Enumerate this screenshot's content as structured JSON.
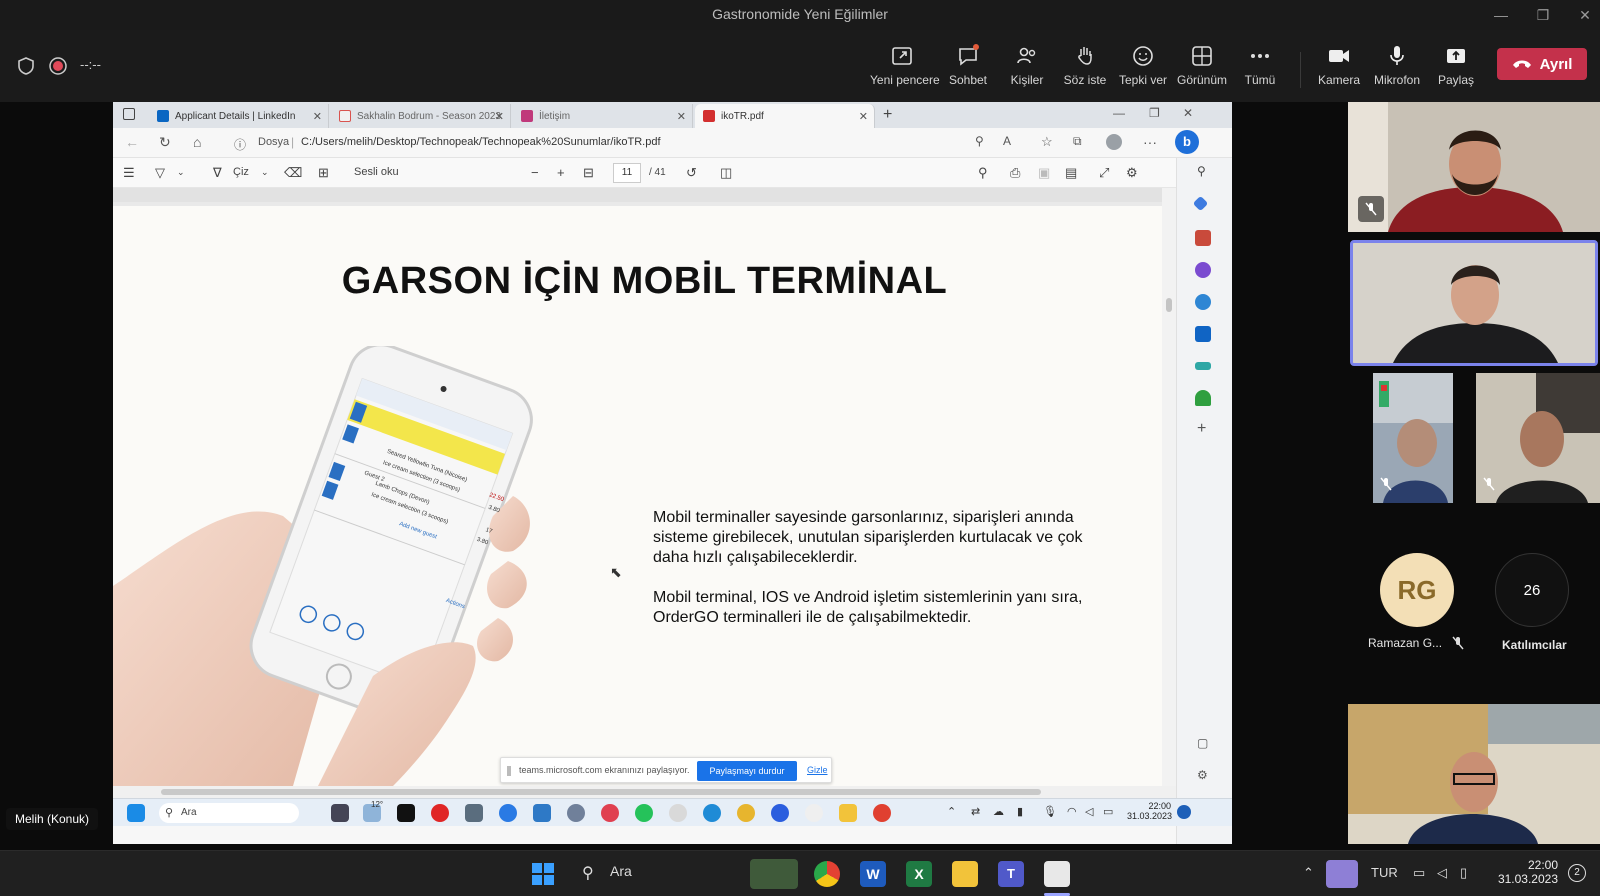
{
  "window": {
    "title": "Gastronomide Yeni Eğilimler"
  },
  "meeting_toolbar": {
    "timer": "--:--",
    "buttons": [
      {
        "label": "Yeni pencere",
        "icon": "new-window-icon"
      },
      {
        "label": "Sohbet",
        "icon": "chat-icon"
      },
      {
        "label": "Kişiler",
        "icon": "people-icon"
      },
      {
        "label": "Söz iste",
        "icon": "raise-hand-icon"
      },
      {
        "label": "Tepki ver",
        "icon": "reaction-icon"
      },
      {
        "label": "Görünüm",
        "icon": "view-icon"
      },
      {
        "label": "Tümü",
        "icon": "more-icon"
      },
      {
        "label": "Kamera",
        "icon": "camera-icon"
      },
      {
        "label": "Mikrofon",
        "icon": "microphone-icon"
      },
      {
        "label": "Paylaş",
        "icon": "share-icon"
      }
    ],
    "leave_label": "Ayrıl"
  },
  "shared_screen": {
    "browser_tabs": [
      {
        "label": "Applicant Details | LinkedIn",
        "color": "#0a66c2"
      },
      {
        "label": "Sakhalin Bodrum - Season 2023",
        "color": "#d9534f"
      },
      {
        "label": "İletişim",
        "color": "#c0397b"
      },
      {
        "label": "ikoTR.pdf",
        "color": "#d32f2f",
        "active": true
      }
    ],
    "address": {
      "protocol": "Dosya",
      "url": "C:/Users/melih/Desktop/Technopeak/Technopeak%20Sunumlar/ikoTR.pdf"
    },
    "pdf_toolbar": {
      "draw_label": "Çiz",
      "read_aloud_label": "Sesli oku",
      "current_page": "11",
      "total_pages": "/ 41"
    },
    "pdf": {
      "title": "GARSON İÇİN MOBİL TERMİNAL",
      "paragraph_1": "Mobil terminaller sayesinde garsonlarınız, siparişleri anında sisteme girebilecek, unutulan siparişlerden kurtulacak ve çok daha hızlı çalışabileceklerdir.",
      "paragraph_2": "Mobil terminal, IOS ve Android işletim sistemlerinin yanı sıra, OrderGO terminalleri ile de çalışabilmektedir.",
      "phone_screen": {
        "item_1": "Seared Yellowfin Tuna (Nicoise)",
        "price_1": "22.50",
        "item_2": "Ice cream selection (3 scoops)",
        "price_2": "3.80",
        "seat": "Guest 2",
        "item_3": "Lamb Chops (Devon)",
        "item_4": "Ice cream selection (3 scoops)",
        "price_3": "17",
        "price_4": "3.80",
        "add_guest": "Add new guest",
        "actions": "Actions"
      }
    },
    "share_notice": {
      "text": "teams.microsoft.com ekranınızı paylaşıyor.",
      "stop_label": "Paylaşmayı durdur",
      "hide_label": "Gizle"
    },
    "inner_taskbar": {
      "search": "Ara",
      "time": "22:00",
      "date": "31.03.2023",
      "temp": "12°"
    }
  },
  "participants": {
    "ramazan": {
      "initials": "RG",
      "name": "Ramazan G..."
    },
    "count_badge": "26",
    "count_label": "Katılımcılar"
  },
  "presenter_label": "Melih (Konuk)",
  "taskbar": {
    "search": "Ara",
    "language": "TUR",
    "time": "22:00",
    "date": "31.03.2023",
    "notifications": "2"
  }
}
